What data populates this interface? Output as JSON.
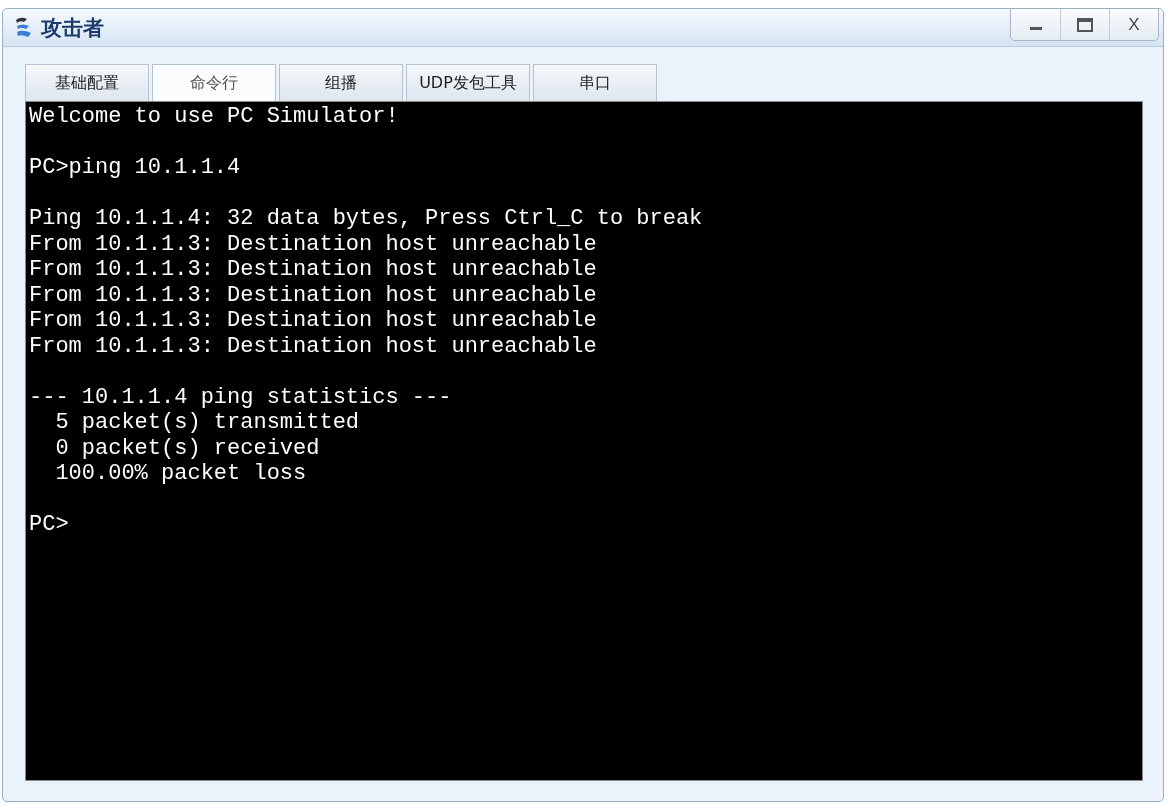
{
  "window": {
    "title": "攻击者",
    "close_label": "X"
  },
  "tabs": [
    {
      "label": "基础配置",
      "selected": false
    },
    {
      "label": "命令行",
      "selected": true
    },
    {
      "label": "组播",
      "selected": false
    },
    {
      "label": "UDP发包工具",
      "selected": false
    },
    {
      "label": "串口",
      "selected": false
    }
  ],
  "terminal": {
    "blocks": [
      [
        "Welcome to use PC Simulator!"
      ],
      [
        "PC>ping 10.1.1.4"
      ],
      [
        "Ping 10.1.1.4: 32 data bytes, Press Ctrl_C to break",
        "From 10.1.1.3: Destination host unreachable",
        "From 10.1.1.3: Destination host unreachable",
        "From 10.1.1.3: Destination host unreachable",
        "From 10.1.1.3: Destination host unreachable",
        "From 10.1.1.3: Destination host unreachable"
      ],
      [
        "--- 10.1.1.4 ping statistics ---",
        "  5 packet(s) transmitted",
        "  0 packet(s) received",
        "  100.00% packet loss"
      ],
      [
        "PC>"
      ]
    ]
  }
}
